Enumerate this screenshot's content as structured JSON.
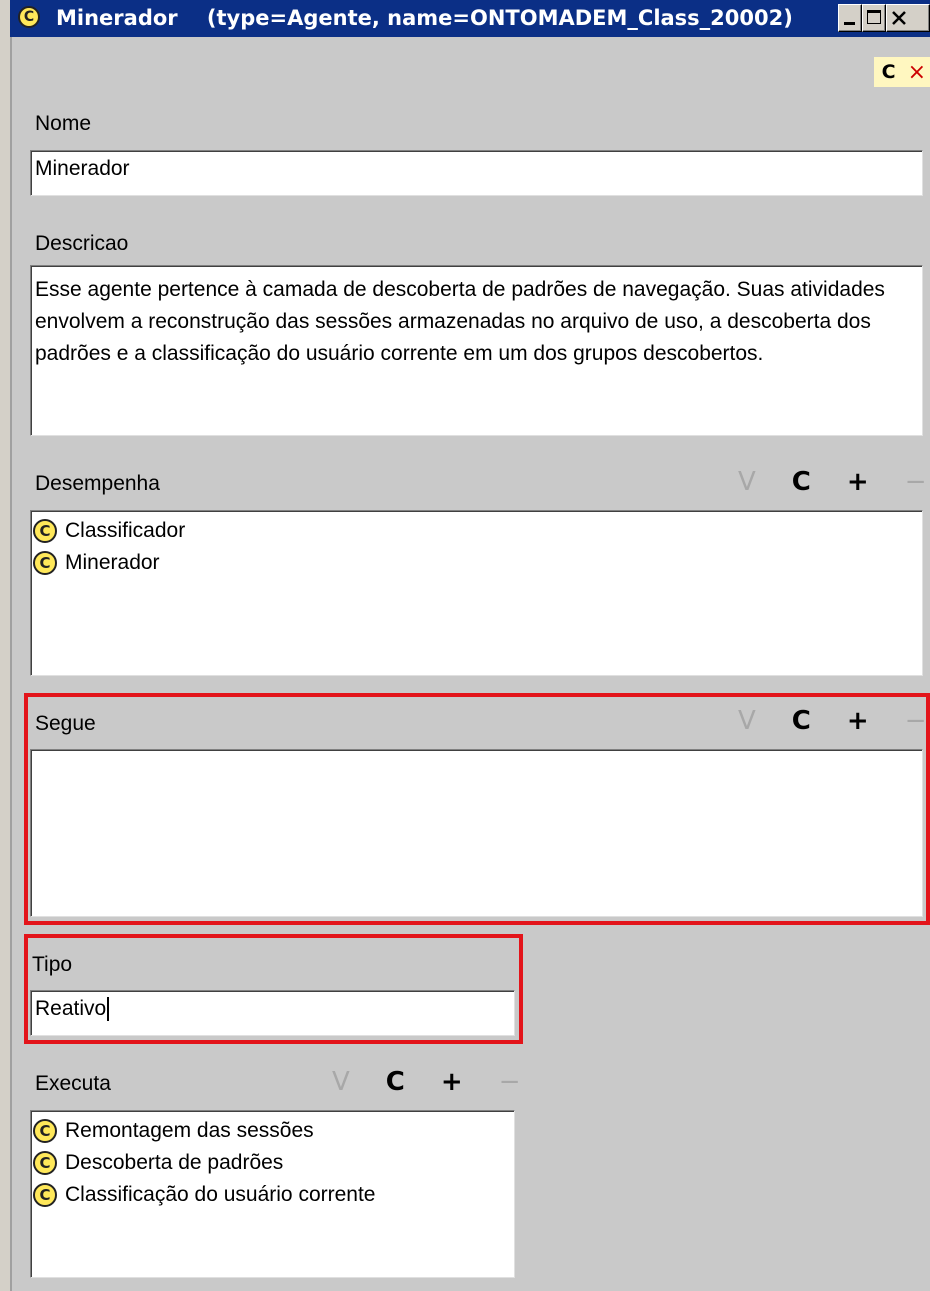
{
  "window": {
    "title_name": "Minerador",
    "title_meta": "(type=Agente, name=ONTOMADEM_Class_20002)"
  },
  "toolstrip": {
    "c_label": "C",
    "x_label": "×"
  },
  "action_glyphs": {
    "view": "V",
    "create": "C",
    "add": "+",
    "remove": "−"
  },
  "icons": {
    "class_icon": "C"
  },
  "nome": {
    "label": "Nome",
    "value": "Minerador"
  },
  "descricao": {
    "label": "Descricao",
    "value": "Esse agente pertence à camada de descoberta de padrões de navegação. Suas atividades envolvem a reconstrução das sessões armazenadas no arquivo de uso, a descoberta dos padrões e a classificação do usuário corrente em um dos grupos descobertos."
  },
  "desempenha": {
    "label": "Desempenha",
    "items": [
      "Classificador",
      "Minerador"
    ]
  },
  "segue": {
    "label": "Segue",
    "items": []
  },
  "tipo": {
    "label": "Tipo",
    "value": "Reativo"
  },
  "executa": {
    "label": "Executa",
    "items": [
      "Remontagem das sessões",
      "Descoberta de padrões",
      "Classificação do usuário corrente"
    ]
  },
  "colors": {
    "titlebar": "#0b2f86",
    "highlight": "#e3141a",
    "class_icon": "#ffe85a"
  }
}
